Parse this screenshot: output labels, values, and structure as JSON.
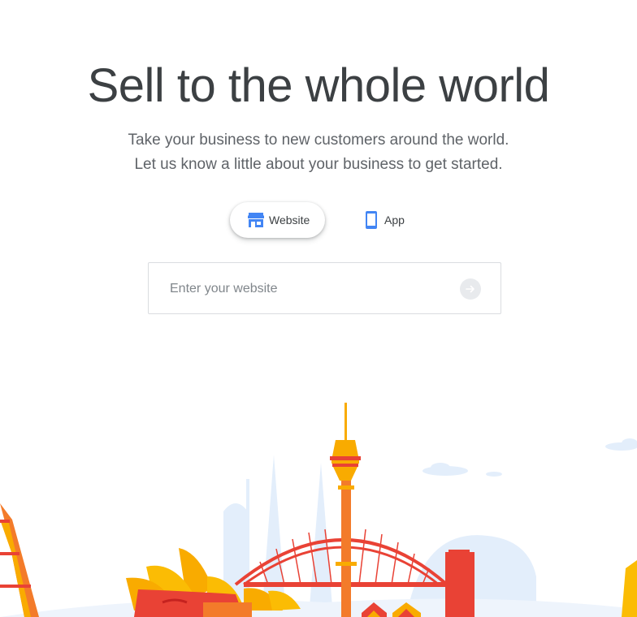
{
  "hero": {
    "title": "Sell to the whole world",
    "subtitle_line1": "Take your business to new customers around the world.",
    "subtitle_line2": "Let us know a little about your business to get started."
  },
  "toggle": {
    "website_label": "Website",
    "website_icon": "store-icon",
    "app_label": "App",
    "app_icon": "smartphone-icon",
    "selected": "Website"
  },
  "url_input": {
    "placeholder": "Enter your website",
    "value": "",
    "submit_icon": "arrow-forward-icon"
  },
  "colors": {
    "text": "#3c4043",
    "google_blue": "#4285f4",
    "orange": "#f37b2a",
    "yellow": "#fbbc04",
    "red": "#ea4335",
    "sky": "#e3eefb"
  }
}
